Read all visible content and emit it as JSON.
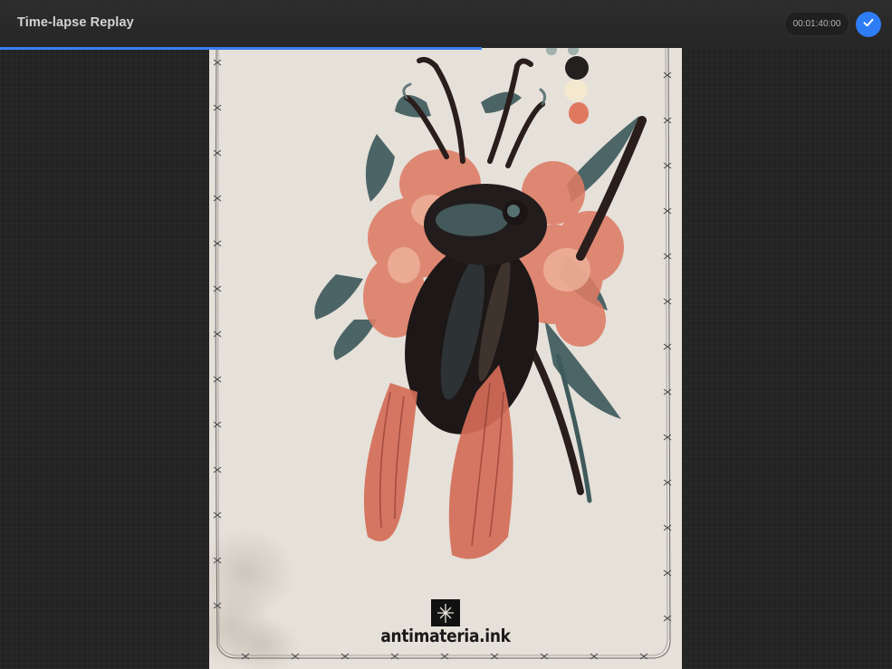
{
  "app": {
    "title": "Time-lapse Replay"
  },
  "playback": {
    "timecode": "00:01:40:00",
    "progress": 0.54
  },
  "artwork": {
    "watermark_text": "antimateria.ink",
    "palette_colors": [
      "#23201f",
      "#f4e8cf",
      "#e07860",
      "#9fb0ad"
    ]
  },
  "colors": {
    "accent": "#2f7df6",
    "background": "#232323",
    "canvas": "#e7e2da"
  },
  "icons": {
    "done": "checkmark-icon"
  }
}
